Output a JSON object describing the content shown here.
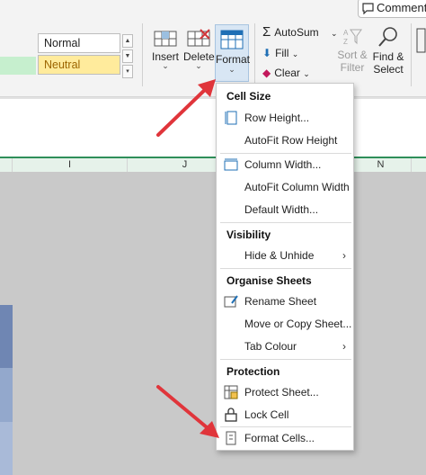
{
  "top_button": {
    "label": "Comments"
  },
  "styles": {
    "items": [
      "Normal",
      "Neutral"
    ]
  },
  "cells_group": {
    "insert_label": "Insert",
    "delete_label": "Delete",
    "format_label": "Format"
  },
  "editing": {
    "autosum_label": "AutoSum",
    "fill_label": "Fill",
    "clear_label": "Clear",
    "sort_label_1": "Sort &",
    "sort_label_2": "Filter",
    "find_label_1": "Find &",
    "find_label_2": "Select"
  },
  "columns": [
    "I",
    "J",
    "N"
  ],
  "menu": {
    "sections": [
      {
        "header": "Cell Size",
        "items": [
          "Row Height...",
          "AutoFit Row Height",
          "Column Width...",
          "AutoFit Column Width",
          "Default Width..."
        ]
      },
      {
        "header": "Visibility",
        "items": [
          "Hide & Unhide"
        ]
      },
      {
        "header": "Organise Sheets",
        "items": [
          "Rename Sheet",
          "Move or Copy Sheet...",
          "Tab Colour"
        ]
      },
      {
        "header": "Protection",
        "items": [
          "Protect Sheet...",
          "Lock Cell",
          "Format Cells..."
        ]
      }
    ]
  },
  "colors": {
    "accent_red": "#e0353b",
    "format_highlight": "#d8e6f4",
    "neutral_fill": "#ffeb9c",
    "good_fill": "#c6efce",
    "header_green": "#2f8f5a"
  }
}
